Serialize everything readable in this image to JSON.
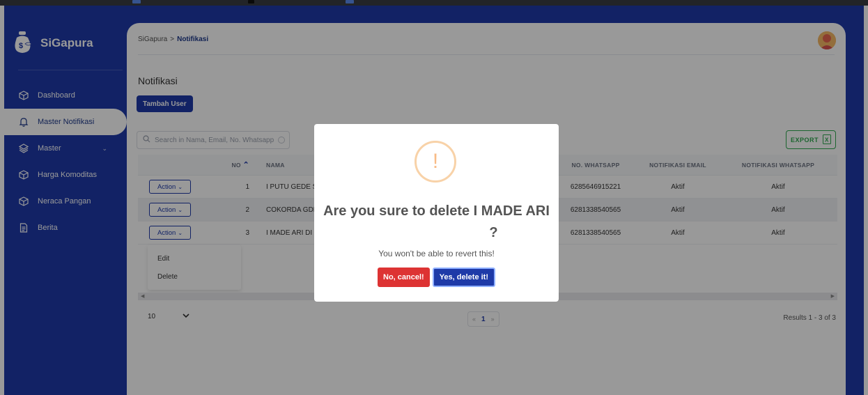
{
  "app": {
    "name": "SiGapura"
  },
  "sidebar": {
    "items": [
      {
        "label": "Dashboard",
        "icon": "cube-icon"
      },
      {
        "label": "Master Notifikasi",
        "icon": "bell-icon",
        "active": true
      },
      {
        "label": "Master",
        "icon": "layers-icon",
        "has_children": true
      },
      {
        "label": "Harga Komoditas",
        "icon": "cube-icon"
      },
      {
        "label": "Neraca Pangan",
        "icon": "cube-icon"
      },
      {
        "label": "Berita",
        "icon": "document-icon"
      }
    ]
  },
  "breadcrumb": {
    "root": "SiGapura",
    "separator": ">",
    "current": "Notifikasi"
  },
  "page": {
    "title": "Notifikasi",
    "add_button": "Tambah User"
  },
  "search": {
    "placeholder": "Search in Nama, Email, No. Whatsapp"
  },
  "export": {
    "label": "EXPORT"
  },
  "table": {
    "headers": {
      "no": "NO",
      "nama": "NAMA",
      "wa": "NO. WHATSAPP",
      "notif_email": "NOTIFIKASI EMAIL",
      "notif_wa": "NOTIFIKASI WHATSAPP"
    },
    "action_label": "Action",
    "rows": [
      {
        "no": "1",
        "nama": "I PUTU GEDE S",
        "wa": "6285646915221",
        "notif_email": "Aktif",
        "notif_wa": "Aktif"
      },
      {
        "no": "2",
        "nama": "COKORDA GDE",
        "wa": "6281338540565",
        "notif_email": "Aktif",
        "notif_wa": "Aktif"
      },
      {
        "no": "3",
        "nama": "I MADE ARI DI",
        "wa": "6281338540565",
        "notif_email": "Aktif",
        "notif_wa": "Aktif"
      }
    ]
  },
  "action_menu": {
    "edit": "Edit",
    "delete": "Delete"
  },
  "pagination": {
    "page_size": "10",
    "current_page": "1",
    "prev": "«",
    "next": "»",
    "results": "Results 1 - 3 of 3"
  },
  "modal": {
    "icon": "!",
    "title_line1": "Are you sure to delete I MADE ARI",
    "title_line2": "?",
    "text": "You won't be able to revert this!",
    "cancel": "No, cancel!",
    "confirm": "Yes, delete it!"
  },
  "colors": {
    "primary": "#1e3aa8",
    "danger": "#dd3333",
    "success": "#2fa84f",
    "warning_ring": "#f8bb86"
  }
}
